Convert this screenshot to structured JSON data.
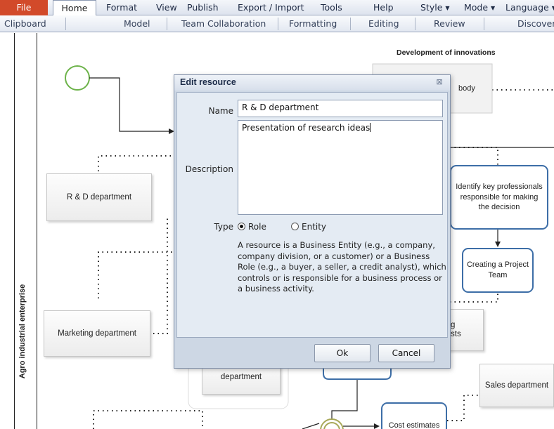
{
  "menu": {
    "file": "File",
    "home": "Home",
    "format": "Format",
    "view": "View",
    "publish": "Publish",
    "export_import": "Export / Import",
    "tools": "Tools",
    "help": "Help",
    "style": "Style",
    "mode": "Mode",
    "language": "Language"
  },
  "ribbon_groups": {
    "clipboard": "Clipboard",
    "model": "Model",
    "team": "Team Collaboration",
    "formatting": "Formatting",
    "editing": "Editing",
    "review": "Review",
    "discover": "Discover"
  },
  "diagram": {
    "pool_label": "Agro industrial enterprise",
    "title": "Development of innovations",
    "resources": {
      "rd": "R & D department",
      "marketing": "Marketing department",
      "dept_fragment": "department",
      "sales": "Sales department"
    },
    "tasks": {
      "identify": "Identify key professionals responsible for making the decision",
      "creating": "Creating a Project Team",
      "cost": "Cost estimates"
    },
    "fragments": {
      "body": "body",
      "g": "g",
      "sts": "sts"
    }
  },
  "dialog": {
    "title": "Edit resource",
    "name_label": "Name",
    "name_value": "R & D department",
    "description_label": "Description",
    "description_value": "Presentation of research ideas",
    "type_label": "Type",
    "type_options": [
      "Role",
      "Entity"
    ],
    "type_selected": "Role",
    "help_text": "A resource is a Business Entity (e.g., a company, company division, or a customer) or a Business Role (e.g., a buyer, a seller, a credit analyst), which controls or is responsible for a business process or a business activity.",
    "ok_label": "Ok",
    "cancel_label": "Cancel"
  }
}
